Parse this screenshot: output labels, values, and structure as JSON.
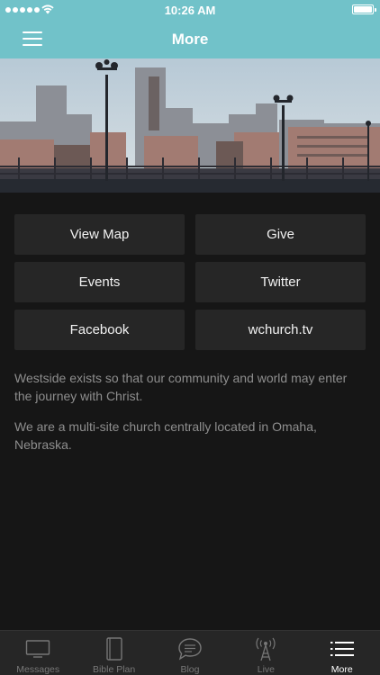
{
  "status_bar": {
    "time": "10:26 AM"
  },
  "header": {
    "title": "More",
    "menu_icon": "hamburger-menu-icon"
  },
  "hero": {
    "image": "city-skyline-photo"
  },
  "links": [
    {
      "label": "View Map"
    },
    {
      "label": "Give"
    },
    {
      "label": "Events"
    },
    {
      "label": "Twitter"
    },
    {
      "label": "Facebook"
    },
    {
      "label": "wchurch.tv"
    }
  ],
  "about": {
    "line1": "Westside exists so that our community and world may enter the journey with Christ.",
    "line2": "We are a multi-site church centrally located in Omaha, Nebraska."
  },
  "tabs": [
    {
      "label": "Messages",
      "icon": "tv-icon"
    },
    {
      "label": "Bible Plan",
      "icon": "book-icon"
    },
    {
      "label": "Blog",
      "icon": "speech-bubble-icon"
    },
    {
      "label": "Live",
      "icon": "broadcast-tower-icon"
    },
    {
      "label": "More",
      "icon": "list-icon",
      "active": true
    }
  ],
  "colors": {
    "header": "#71c2c9",
    "background": "#161616",
    "tile": "#262626",
    "tab_bar": "#262626"
  }
}
